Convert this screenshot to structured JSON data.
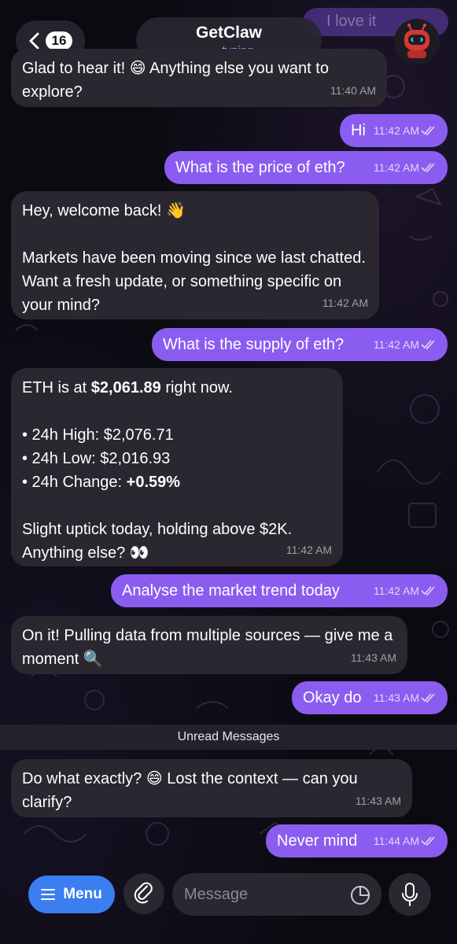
{
  "header": {
    "unread_count": "16",
    "chat_name": "GetClaw",
    "status_text": "typing",
    "status_dots": "•••",
    "ghost_text": "I love it"
  },
  "messages": [
    {
      "dir": "in",
      "text": "Glad to hear it! 😄 Anything else you want to explore?",
      "time": "11:40 AM"
    },
    {
      "dir": "out",
      "text": "Hi",
      "time": "11:42 AM"
    },
    {
      "dir": "out",
      "text": "What is the price of eth?",
      "time": "11:42 AM"
    },
    {
      "dir": "in",
      "text": "Hey, welcome back! 👋\n\nMarkets have been moving since we last chatted. Want a fresh update, or something specific on your mind?",
      "time": "11:42 AM"
    },
    {
      "dir": "out",
      "text": "What is the supply of eth?",
      "time": "11:42 AM"
    },
    {
      "dir": "in",
      "line1_prefix": "ETH is at ",
      "line1_price": "$2,061.89",
      "line1_suffix": " right now.",
      "bullets": [
        "• 24h High: $2,076.71",
        "• 24h Low: $2,016.93"
      ],
      "change_prefix": "• 24h Change: ",
      "change_value": "+0.59%",
      "closing": "Slight uptick today, holding above $2K.\nAnything else? 👀",
      "time": "11:42 AM"
    },
    {
      "dir": "out",
      "text": "Analyse the market trend today",
      "time": "11:42 AM"
    },
    {
      "dir": "in",
      "text": "On it! Pulling data from multiple sources — give me a moment 🔍",
      "time": "11:43 AM"
    },
    {
      "dir": "out",
      "text": "Okay do",
      "time": "11:43 AM"
    },
    {
      "dir": "in",
      "text": "Do what exactly? 😄 Lost the context — can you clarify?",
      "time": "11:43 AM"
    },
    {
      "dir": "out",
      "text": "Never mind",
      "time": "11:44 AM"
    }
  ],
  "unread_divider": "Unread Messages",
  "input_bar": {
    "menu_label": "Menu",
    "placeholder": "Message"
  },
  "colors": {
    "outgoing_bubble": "#8a5df0",
    "incoming_bubble": "#2a2730",
    "menu_button": "#3b7ef0",
    "typing_status": "#8ab4ff"
  }
}
